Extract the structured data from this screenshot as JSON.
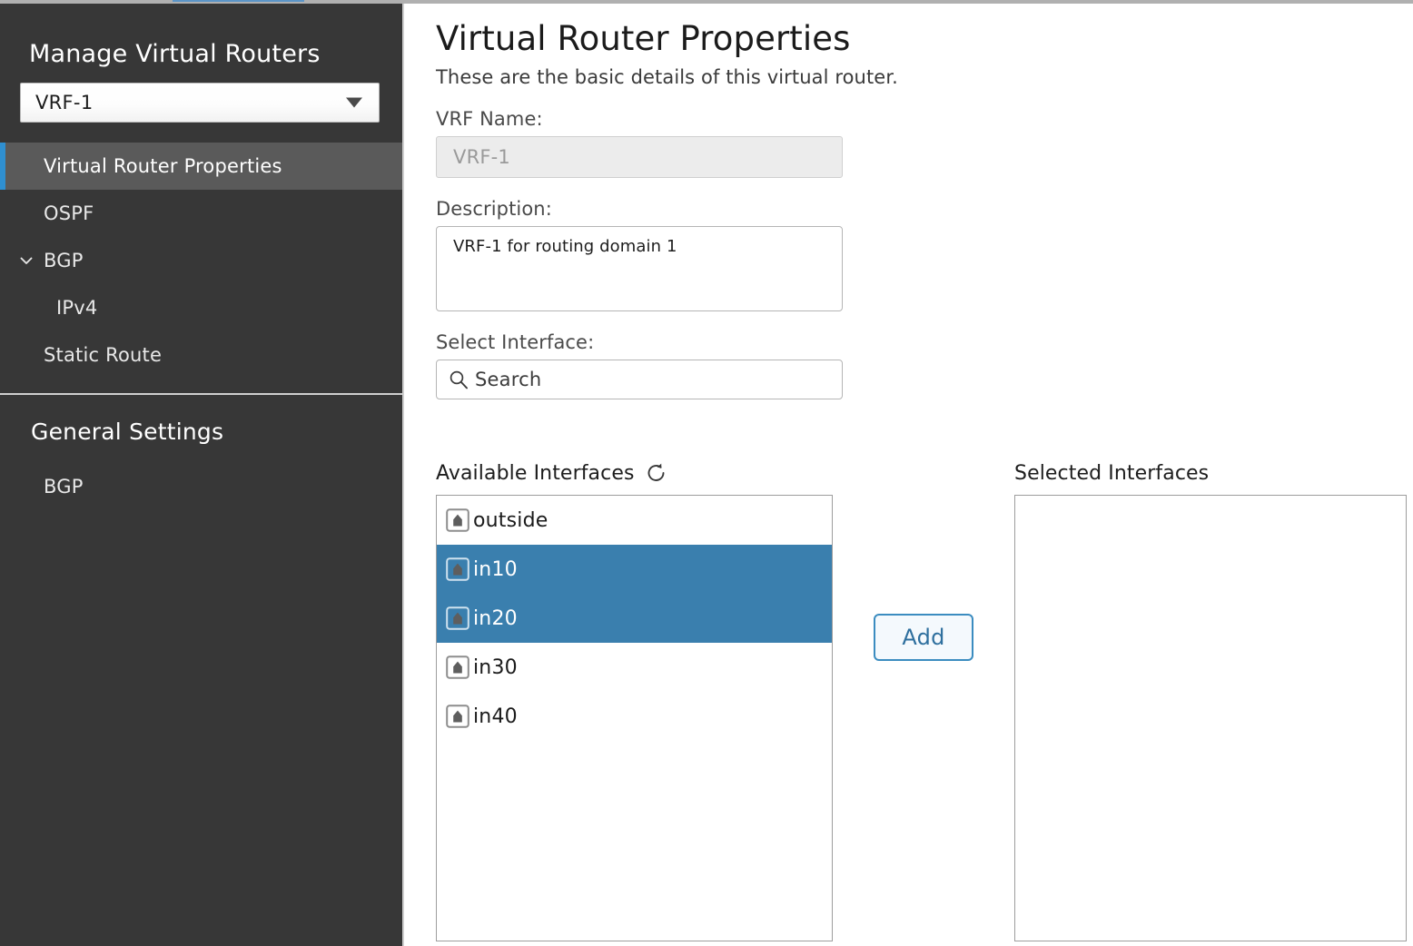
{
  "sidebar": {
    "title": "Manage Virtual Routers",
    "router_select": {
      "value": "VRF-1",
      "caret_icon": "chevron-down-icon"
    },
    "nav_items": [
      {
        "label": "Virtual Router Properties",
        "active": true,
        "sub": false,
        "expandable": false
      },
      {
        "label": "OSPF",
        "active": false,
        "sub": false,
        "expandable": false
      },
      {
        "label": "BGP",
        "active": false,
        "sub": false,
        "expandable": true
      },
      {
        "label": "IPv4",
        "active": false,
        "sub": true,
        "expandable": false
      },
      {
        "label": "Static Route",
        "active": false,
        "sub": false,
        "expandable": false
      }
    ],
    "section_title": "General Settings",
    "section_items": [
      {
        "label": "BGP",
        "active": false,
        "sub": false,
        "expandable": false
      }
    ]
  },
  "main": {
    "title": "Virtual Router Properties",
    "subtitle": "These are the basic details of this virtual router.",
    "vrf_name": {
      "label": "VRF Name:",
      "value": "VRF-1"
    },
    "description": {
      "label": "Description:",
      "value": "VRF-1 for routing domain 1"
    },
    "select_interface": {
      "label": "Select Interface:",
      "search_placeholder": "Search",
      "search_value": "Search",
      "search_icon": "search-icon"
    },
    "available": {
      "header": "Available Interfaces",
      "refresh_icon": "refresh-icon",
      "items": [
        {
          "label": "outside",
          "selected": false,
          "icon": "interface-icon"
        },
        {
          "label": "in10",
          "selected": true,
          "icon": "interface-icon"
        },
        {
          "label": "in20",
          "selected": true,
          "icon": "interface-icon"
        },
        {
          "label": "in30",
          "selected": false,
          "icon": "interface-icon"
        },
        {
          "label": "in40",
          "selected": false,
          "icon": "interface-icon"
        }
      ]
    },
    "add_button": "Add",
    "selected": {
      "header": "Selected Interfaces",
      "items": []
    }
  },
  "colors": {
    "sidebar_bg": "#373737",
    "sidebar_active_bg": "#5a5a5a",
    "accent_blue": "#2f8fd0",
    "list_selection_blue": "#3a7fae",
    "button_blue": "#3b8cc0",
    "button_text_blue": "#2e6f9e"
  }
}
